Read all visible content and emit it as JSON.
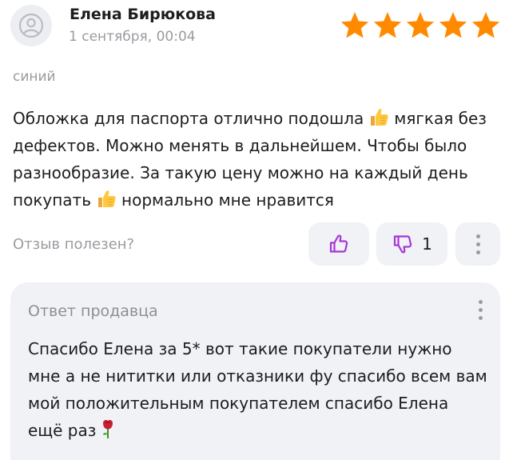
{
  "review": {
    "author": "Елена Бирюкова",
    "date": "1 сентября, 00:04",
    "rating": 5,
    "max_rating": 5,
    "star_color": "#ff8a00",
    "variant": "синий",
    "text_part1": "Обложка для паспорта отлично подошла",
    "text_part2": "мягкая без дефектов. Можно менять в дальнейшем. Чтобы было разнообразие. За такую цену можно на каждый день покупать",
    "text_part3": "нормально мне нравится",
    "emoji_icon": "thumbs-up-emoji"
  },
  "feedback": {
    "helpful_label": "Отзыв полезен?",
    "dislike_count": "1",
    "accent_color": "#a637d6"
  },
  "seller_reply": {
    "title": "Ответ продавца",
    "text": "Спасибо Елена за 5* вот такие покупатели нужно мне а не нититки или отказники фу спасибо всем вам мой положительным покупателем спасибо Елена ещё раз",
    "emoji_icon": "rose-emoji"
  }
}
